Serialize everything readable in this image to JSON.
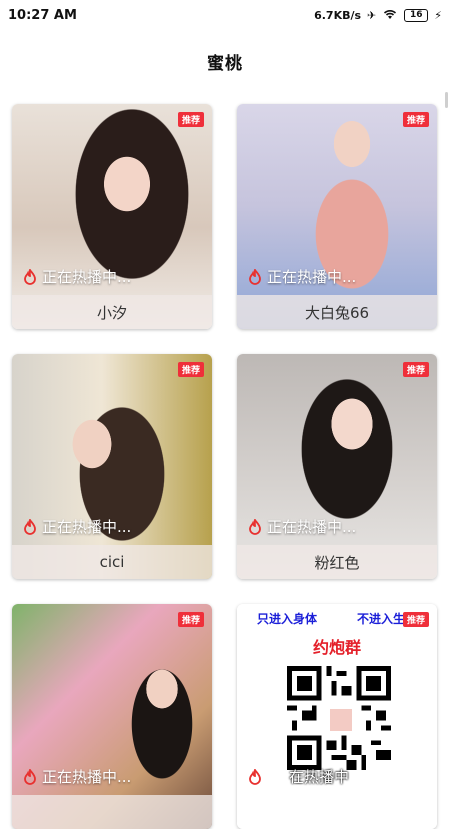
{
  "status_bar": {
    "time": "10:27 AM",
    "network_speed": "6.7KB/s",
    "battery": "16"
  },
  "header": {
    "title": "蜜桃"
  },
  "cards": [
    {
      "name": "小汐",
      "tag": "推荐",
      "live_text": "正在热播中..."
    },
    {
      "name": "大白兔66",
      "tag": "推荐",
      "live_text": "正在热播中..."
    },
    {
      "name": "cici",
      "tag": "推荐",
      "live_text": "正在热播中..."
    },
    {
      "name": "粉红色",
      "tag": "推荐",
      "live_text": "正在热播中..."
    },
    {
      "name": "",
      "tag": "推荐",
      "live_text": "正在热播中..."
    },
    {
      "name": "",
      "tag": "推荐",
      "live_text": "在热播中",
      "ad": {
        "left_text": "只进入身体",
        "right_text": "不进入生活",
        "title": "约炮群"
      }
    }
  ],
  "colors": {
    "tag_bg": "#ef2f3a",
    "ad_blue": "#1b1fd8",
    "ad_red": "#e4202a",
    "flame": "#e8312f"
  },
  "icons": {
    "airplane": "airplane-icon",
    "wifi": "wifi-icon",
    "battery": "battery-icon",
    "charging": "charging-icon",
    "flame": "flame-icon"
  }
}
